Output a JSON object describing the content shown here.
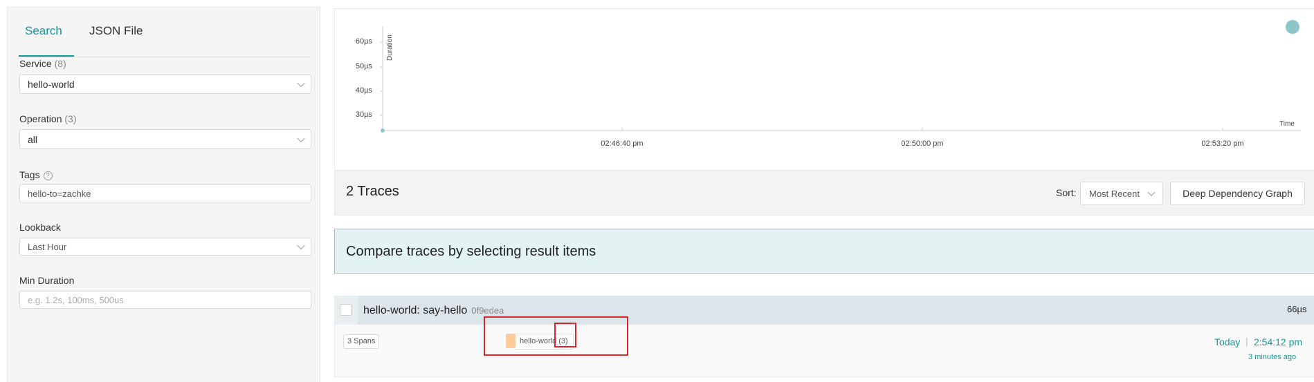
{
  "search_panel": {
    "tabs": [
      "Search",
      "JSON File"
    ],
    "active_tab": "Search",
    "service": {
      "label": "Service",
      "count": "(8)",
      "value": "hello-world"
    },
    "operation": {
      "label": "Operation",
      "count": "(3)",
      "value": "all"
    },
    "tags": {
      "label": "Tags",
      "help_icon": "?",
      "value": "hello-to=zachke"
    },
    "lookback": {
      "label": "Lookback",
      "value": "Last Hour"
    },
    "min_duration": {
      "label": "Min Duration",
      "placeholder": "e.g. 1.2s, 100ms, 500us"
    }
  },
  "chart_data": {
    "type": "scatter",
    "ylabel": "Duration",
    "xlabel": "Time",
    "y_ticks": [
      "30µs",
      "40µs",
      "50µs",
      "60µs"
    ],
    "x_ticks": [
      "02:46:40 pm",
      "02:50:00 pm",
      "02:53:20 pm"
    ],
    "points": [
      {
        "time": "02:54:12 pm",
        "duration_us": 66
      }
    ],
    "point_color": "#8cc6c9"
  },
  "results_header": {
    "count_label": "2 Traces",
    "sort_label": "Sort:",
    "sort_value": "Most Recent",
    "deep_dependency_button": "Deep Dependency Graph"
  },
  "compare_banner": {
    "text": "Compare traces by selecting result items"
  },
  "traces": [
    {
      "title": "hello-world: say-hello",
      "id": "0f9edea",
      "duration": "66µs",
      "spans": "3 Spans",
      "service_tag": {
        "name": "hello-world",
        "count": "(3)",
        "color": "#ffcb98"
      },
      "date": "Today",
      "time": "2:54:12 pm",
      "ago": "3 minutes ago"
    }
  ],
  "colors": {
    "accent": "#119999",
    "highlight_red": "#e0242b"
  }
}
